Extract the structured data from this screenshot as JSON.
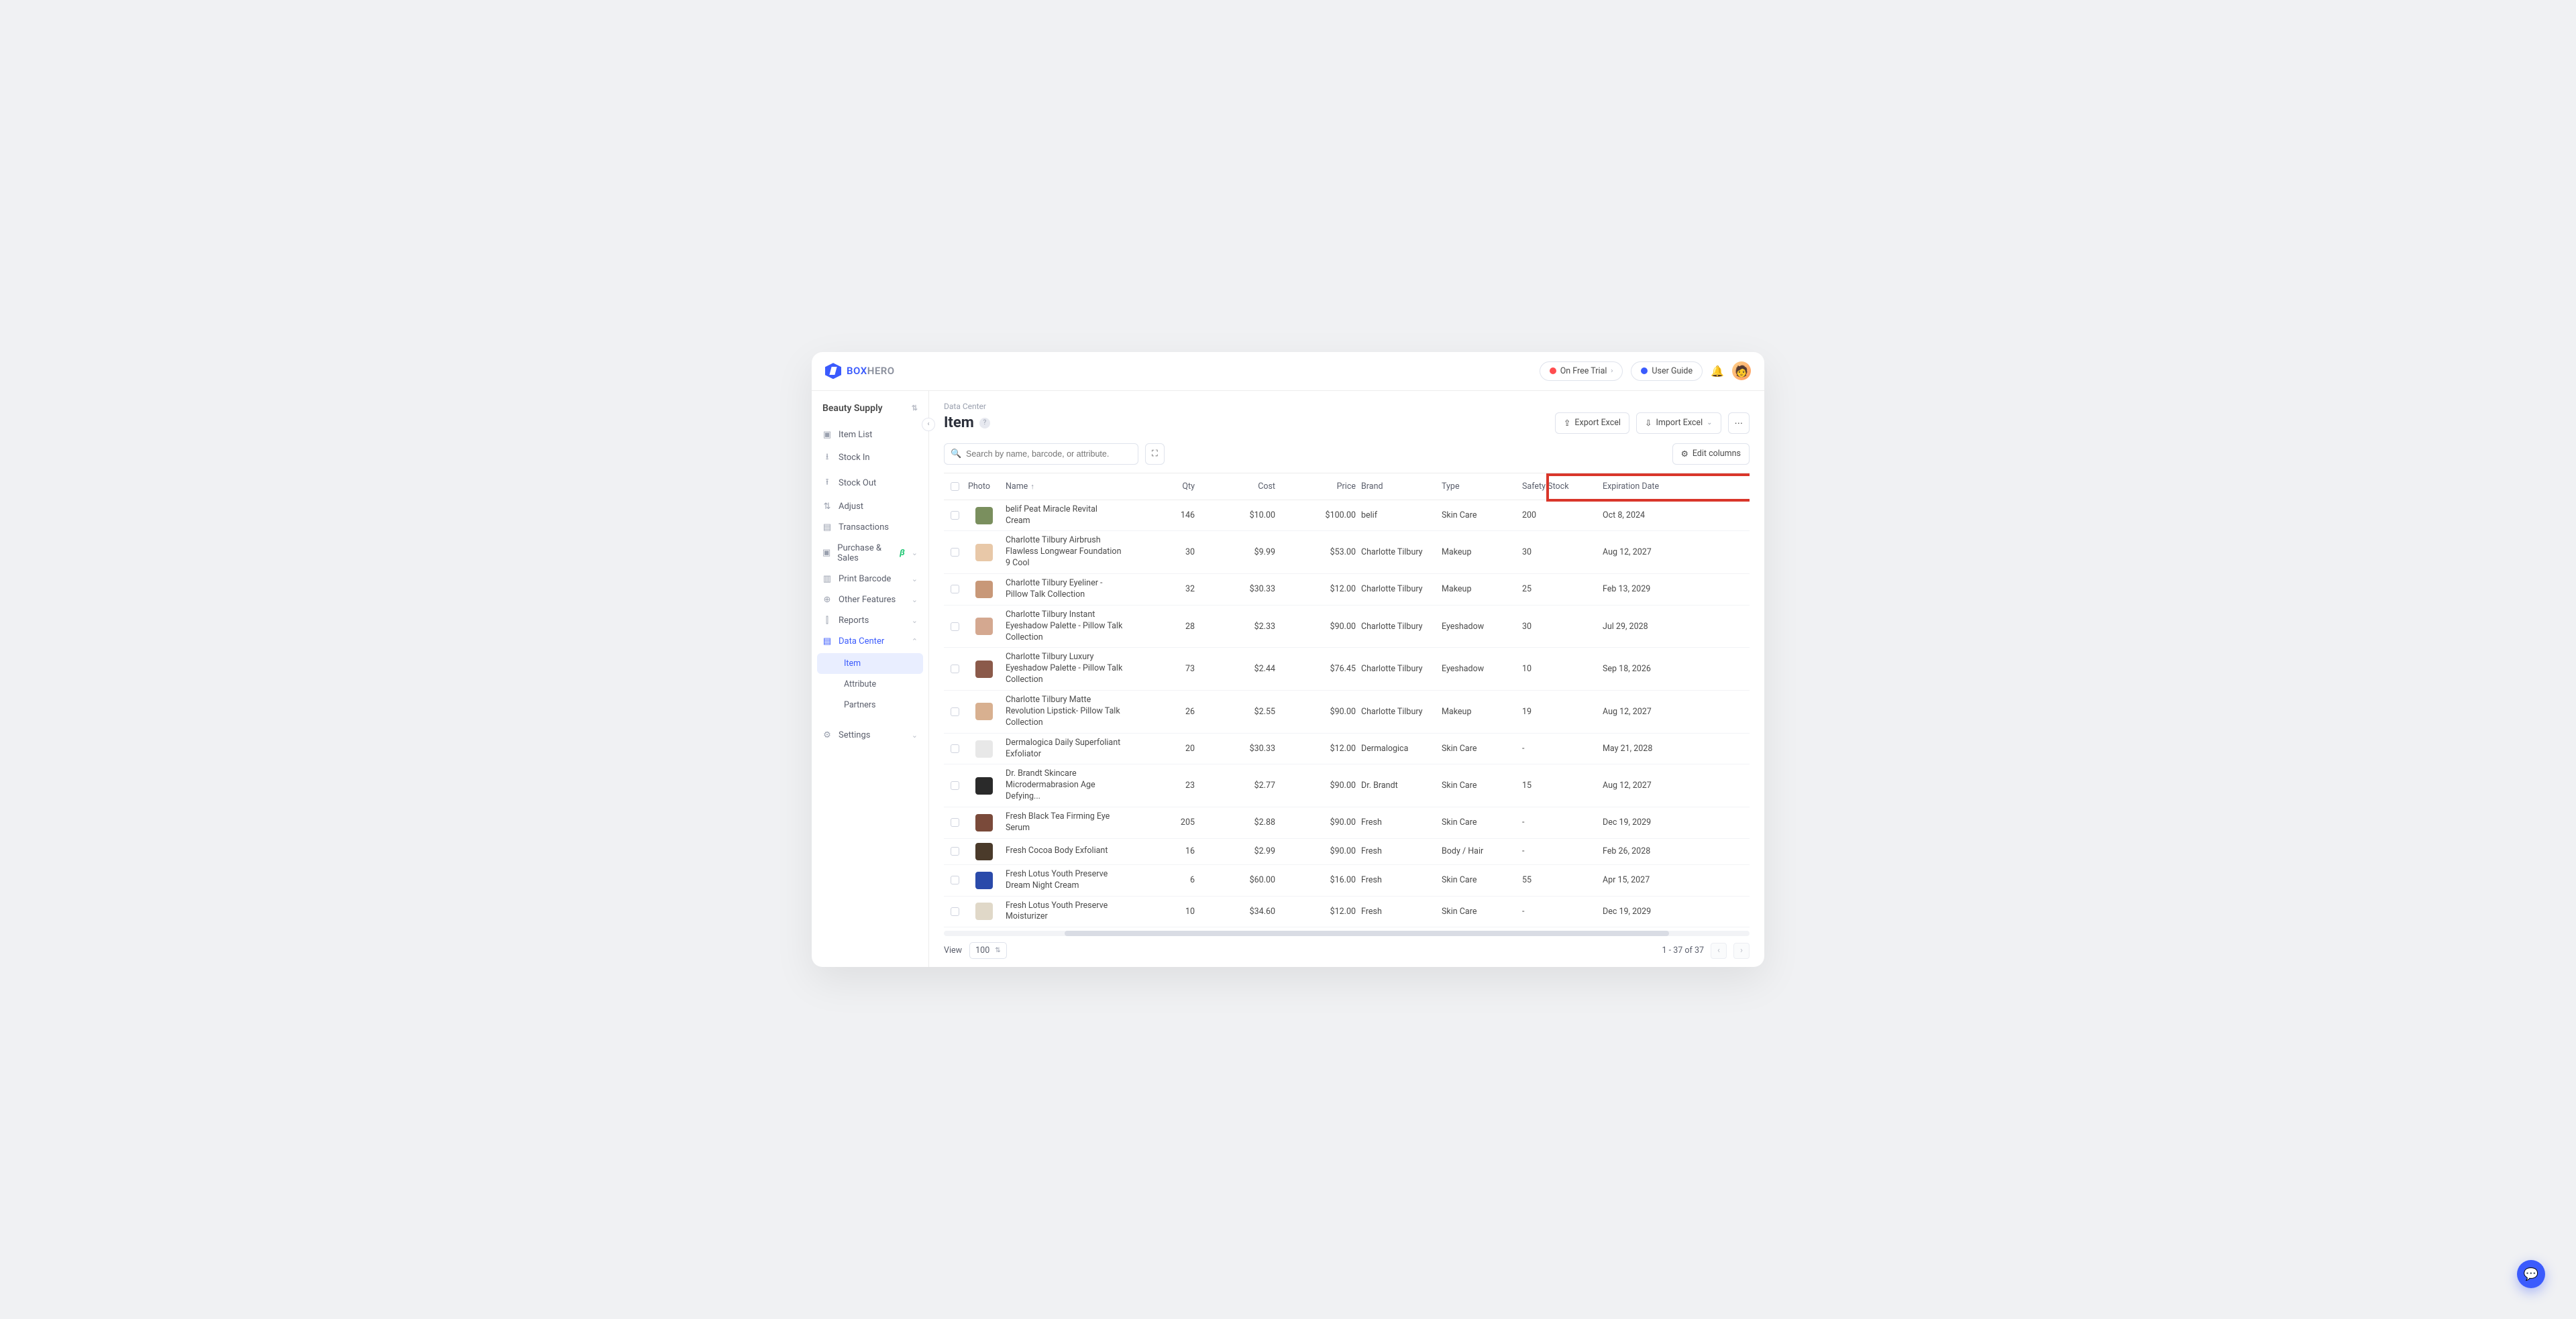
{
  "brand": {
    "part1": "BOX",
    "part2": "HERO"
  },
  "topbar": {
    "trial": "On Free Trial",
    "guide": "User Guide"
  },
  "team": {
    "name": "Beauty Supply"
  },
  "sidebar": {
    "items": [
      {
        "icon": "▣",
        "label": "Item List"
      },
      {
        "icon": "⭳",
        "label": "Stock In"
      },
      {
        "icon": "⭱",
        "label": "Stock Out"
      },
      {
        "icon": "⇅",
        "label": "Adjust"
      },
      {
        "icon": "▤",
        "label": "Transactions"
      },
      {
        "icon": "▣",
        "label": "Purchase & Sales",
        "beta": "β",
        "chev": "⌄"
      },
      {
        "icon": "▥",
        "label": "Print Barcode",
        "chev": "⌄"
      },
      {
        "icon": "⊕",
        "label": "Other Features",
        "chev": "⌄"
      },
      {
        "icon": "⫿",
        "label": "Reports",
        "chev": "⌄"
      },
      {
        "icon": "▤",
        "label": "Data Center",
        "chev": "⌃",
        "active": true
      }
    ],
    "sub": [
      {
        "label": "Item",
        "active": true
      },
      {
        "label": "Attribute"
      },
      {
        "label": "Partners"
      }
    ],
    "settings": {
      "icon": "⚙",
      "label": "Settings",
      "chev": "⌄"
    }
  },
  "breadcrumb": "Data Center",
  "page_title": "Item",
  "actions": {
    "export": "Export Excel",
    "import": "Import Excel",
    "edit_columns": "Edit columns"
  },
  "search": {
    "placeholder": "Search by name, barcode, or attribute."
  },
  "columns": {
    "photo": "Photo",
    "name": "Name",
    "qty": "Qty",
    "cost": "Cost",
    "price": "Price",
    "brand": "Brand",
    "type": "Type",
    "safety": "Safety Stock",
    "exp": "Expiration Date"
  },
  "rows": [
    {
      "name": "belif Peat Miracle Revital Cream",
      "qty": "146",
      "cost": "$10.00",
      "price": "$100.00",
      "brand": "belif",
      "type": "Skin Care",
      "safety": "200",
      "exp": "Oct 8, 2024",
      "thumb": "#7a8f5e"
    },
    {
      "name": "Charlotte Tilbury Airbrush Flawless Longwear Foundation 9 Cool",
      "qty": "30",
      "cost": "$9.99",
      "price": "$53.00",
      "brand": "Charlotte Tilbury",
      "type": "Makeup",
      "safety": "30",
      "exp": "Aug 12, 2027",
      "thumb": "#e8c8a8"
    },
    {
      "name": "Charlotte Tilbury Eyeliner - Pillow Talk Collection",
      "qty": "32",
      "cost": "$30.33",
      "price": "$12.00",
      "brand": "Charlotte Tilbury",
      "type": "Makeup",
      "safety": "25",
      "exp": "Feb 13, 2029",
      "thumb": "#c89878"
    },
    {
      "name": "Charlotte Tilbury Instant Eyeshadow Palette - Pillow Talk Collection",
      "qty": "28",
      "cost": "$2.33",
      "price": "$90.00",
      "brand": "Charlotte Tilbury",
      "type": "Eyeshadow",
      "safety": "30",
      "exp": "Jul 29, 2028",
      "thumb": "#d4a890"
    },
    {
      "name": "Charlotte Tilbury Luxury Eyeshadow Palette - Pillow Talk Collection",
      "qty": "73",
      "cost": "$2.44",
      "price": "$76.45",
      "brand": "Charlotte Tilbury",
      "type": "Eyeshadow",
      "safety": "10",
      "exp": "Sep 18, 2026",
      "thumb": "#8b5a4a"
    },
    {
      "name": "Charlotte Tilbury Matte Revolution Lipstick- Pillow Talk Collection",
      "qty": "26",
      "cost": "$2.55",
      "price": "$90.00",
      "brand": "Charlotte Tilbury",
      "type": "Makeup",
      "safety": "19",
      "exp": "Aug 12, 2027",
      "thumb": "#d8b090"
    },
    {
      "name": "Dermalogica Daily Superfoliant Exfoliator",
      "qty": "20",
      "cost": "$30.33",
      "price": "$12.00",
      "brand": "Dermalogica",
      "type": "Skin Care",
      "safety": "-",
      "exp": "May 21, 2028",
      "thumb": "#e8e8e8"
    },
    {
      "name": "Dr. Brandt Skincare Microdermabrasion Age Defying...",
      "qty": "23",
      "cost": "$2.77",
      "price": "$90.00",
      "brand": "Dr. Brandt",
      "type": "Skin Care",
      "safety": "15",
      "exp": "Aug 12, 2027",
      "thumb": "#2a2a2a"
    },
    {
      "name": "Fresh Black Tea Firming Eye Serum",
      "qty": "205",
      "cost": "$2.88",
      "price": "$90.00",
      "brand": "Fresh",
      "type": "Skin Care",
      "safety": "-",
      "exp": "Dec 19, 2029",
      "thumb": "#7a4a3a"
    },
    {
      "name": "Fresh Cocoa Body Exfoliant",
      "qty": "16",
      "cost": "$2.99",
      "price": "$90.00",
      "brand": "Fresh",
      "type": "Body / Hair",
      "safety": "-",
      "exp": "Feb 26, 2028",
      "thumb": "#4a3a2a"
    },
    {
      "name": "Fresh Lotus Youth Preserve Dream Night Cream",
      "qty": "6",
      "cost": "$60.00",
      "price": "$16.00",
      "brand": "Fresh",
      "type": "Skin Care",
      "safety": "55",
      "exp": "Apr 15, 2027",
      "thumb": "#2a4aaa"
    },
    {
      "name": "Fresh Lotus Youth Preserve Moisturizer",
      "qty": "10",
      "cost": "$34.60",
      "price": "$12.00",
      "brand": "Fresh",
      "type": "Skin Care",
      "safety": "-",
      "exp": "Dec 19, 2029",
      "thumb": "#e0d8c8"
    }
  ],
  "footer": {
    "view_label": "View",
    "page_size": "100",
    "range": "1 - 37 of 37"
  }
}
